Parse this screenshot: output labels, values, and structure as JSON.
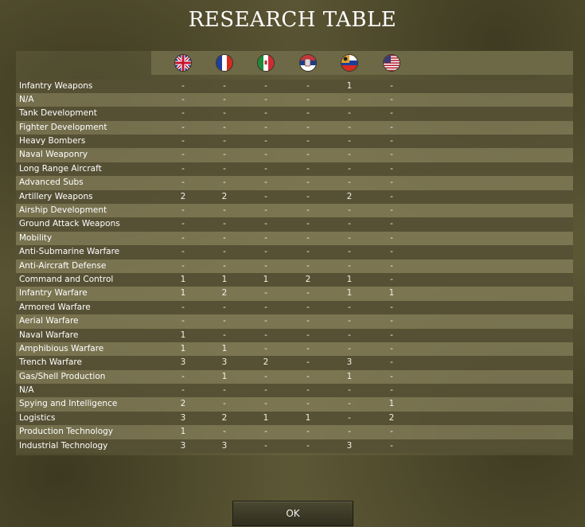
{
  "title": "RESEARCH TABLE",
  "nations": [
    {
      "name": "uk-flag-icon"
    },
    {
      "name": "france-flag-icon"
    },
    {
      "name": "italy-flag-icon"
    },
    {
      "name": "serbia-flag-icon"
    },
    {
      "name": "russia-flag-icon"
    },
    {
      "name": "usa-flag-icon"
    }
  ],
  "rows": [
    {
      "tech": "Infantry Weapons",
      "values": [
        "-",
        "-",
        "-",
        "-",
        "1",
        "-"
      ]
    },
    {
      "tech": "N/A",
      "values": [
        "-",
        "-",
        "-",
        "-",
        "-",
        "-"
      ]
    },
    {
      "tech": "Tank Development",
      "values": [
        "-",
        "-",
        "-",
        "-",
        "-",
        "-"
      ]
    },
    {
      "tech": "Fighter Development",
      "values": [
        "-",
        "-",
        "-",
        "-",
        "-",
        "-"
      ]
    },
    {
      "tech": "Heavy Bombers",
      "values": [
        "-",
        "-",
        "-",
        "-",
        "-",
        "-"
      ]
    },
    {
      "tech": "Naval Weaponry",
      "values": [
        "-",
        "-",
        "-",
        "-",
        "-",
        "-"
      ]
    },
    {
      "tech": "Long Range Aircraft",
      "values": [
        "-",
        "-",
        "-",
        "-",
        "-",
        "-"
      ]
    },
    {
      "tech": "Advanced Subs",
      "values": [
        "-",
        "-",
        "-",
        "-",
        "-",
        "-"
      ]
    },
    {
      "tech": "Artillery Weapons",
      "values": [
        "2",
        "2",
        "-",
        "-",
        "2",
        "-"
      ]
    },
    {
      "tech": "Airship Development",
      "values": [
        "-",
        "-",
        "-",
        "-",
        "-",
        "-"
      ]
    },
    {
      "tech": "Ground Attack Weapons",
      "values": [
        "-",
        "-",
        "-",
        "-",
        "-",
        "-"
      ]
    },
    {
      "tech": "Mobility",
      "values": [
        "-",
        "-",
        "-",
        "-",
        "-",
        "-"
      ]
    },
    {
      "tech": "Anti-Submarine Warfare",
      "values": [
        "-",
        "-",
        "-",
        "-",
        "-",
        "-"
      ]
    },
    {
      "tech": "Anti-Aircraft Defense",
      "values": [
        "-",
        "-",
        "-",
        "-",
        "-",
        "-"
      ]
    },
    {
      "tech": "Command and Control",
      "values": [
        "1",
        "1",
        "1",
        "2",
        "1",
        "-"
      ]
    },
    {
      "tech": "Infantry Warfare",
      "values": [
        "1",
        "2",
        "-",
        "-",
        "1",
        "1"
      ]
    },
    {
      "tech": "Armored Warfare",
      "values": [
        "-",
        "-",
        "-",
        "-",
        "-",
        "-"
      ]
    },
    {
      "tech": "Aerial Warfare",
      "values": [
        "-",
        "-",
        "-",
        "-",
        "-",
        "-"
      ]
    },
    {
      "tech": "Naval Warfare",
      "values": [
        "1",
        "-",
        "-",
        "-",
        "-",
        "-"
      ]
    },
    {
      "tech": "Amphibious Warfare",
      "values": [
        "1",
        "1",
        "-",
        "-",
        "-",
        "-"
      ]
    },
    {
      "tech": "Trench Warfare",
      "values": [
        "3",
        "3",
        "2",
        "-",
        "3",
        "-"
      ]
    },
    {
      "tech": "Gas/Shell Production",
      "values": [
        "-",
        "1",
        "-",
        "-",
        "1",
        "-"
      ]
    },
    {
      "tech": "N/A",
      "values": [
        "-",
        "-",
        "-",
        "-",
        "-",
        "-"
      ]
    },
    {
      "tech": "Spying and Intelligence",
      "values": [
        "2",
        "-",
        "-",
        "-",
        "-",
        "1"
      ]
    },
    {
      "tech": "Logistics",
      "values": [
        "3",
        "2",
        "1",
        "1",
        "-",
        "2"
      ]
    },
    {
      "tech": "Production Technology",
      "values": [
        "1",
        "-",
        "-",
        "-",
        "-",
        "-"
      ]
    },
    {
      "tech": "Industrial Technology",
      "values": [
        "3",
        "3",
        "-",
        "-",
        "3",
        "-"
      ]
    }
  ],
  "ok_label": "OK"
}
